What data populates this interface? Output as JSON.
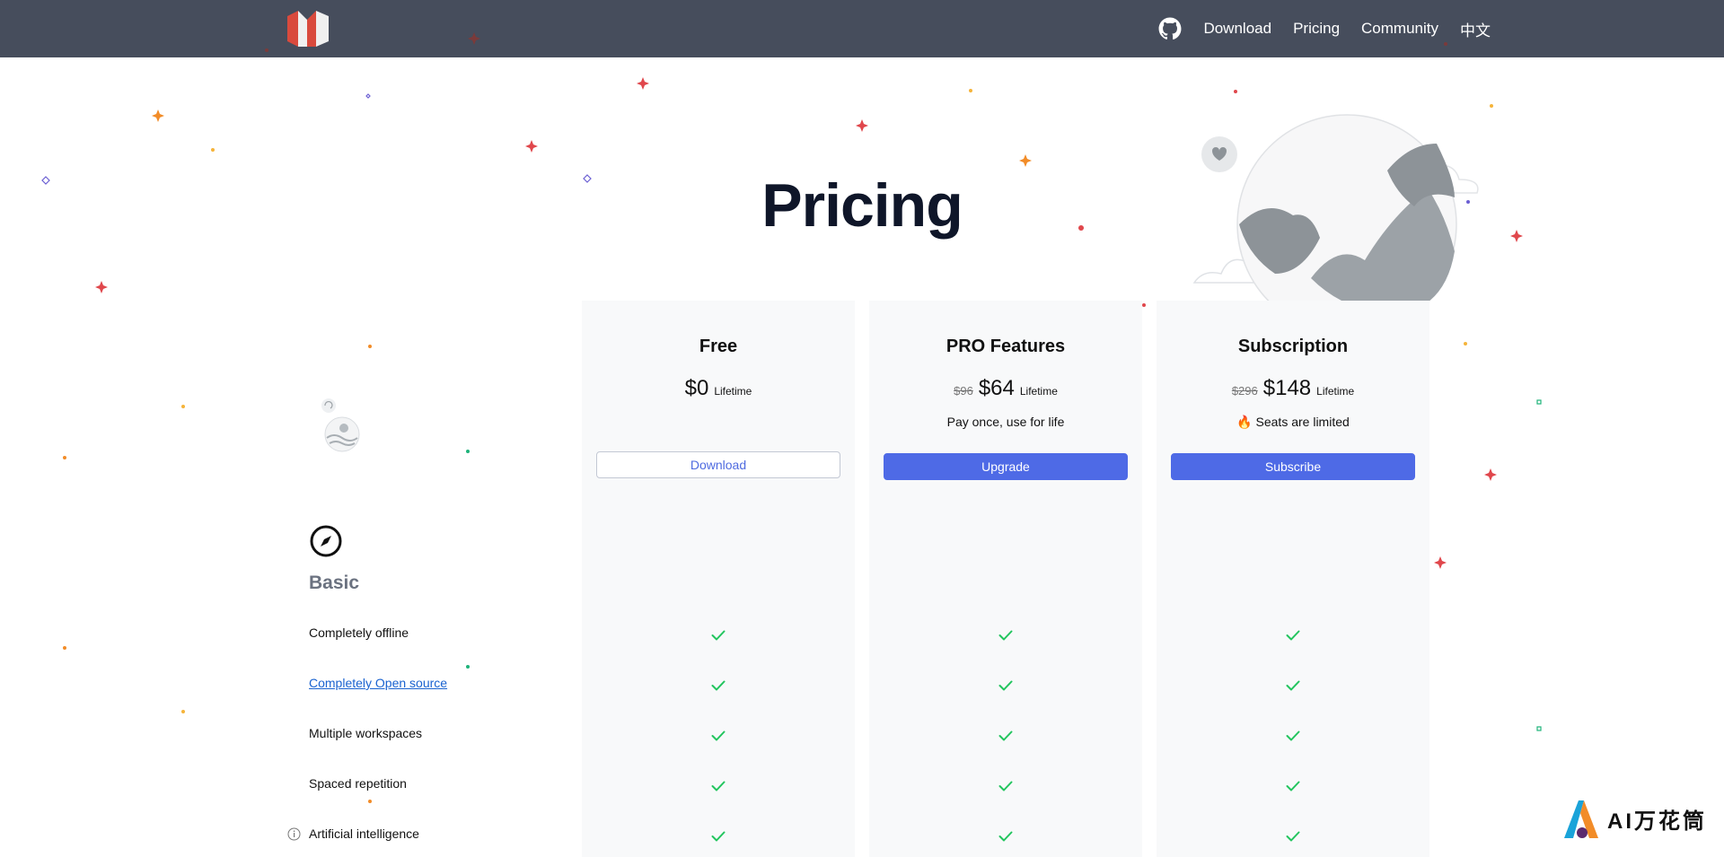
{
  "nav": {
    "links": [
      "Download",
      "Pricing",
      "Community",
      "中文"
    ],
    "icons": {
      "logo": "app-logo",
      "github": "github-icon"
    }
  },
  "page": {
    "title": "Pricing"
  },
  "plans": [
    {
      "name": "Free",
      "old_price": "",
      "price": "$0",
      "period": "Lifetime",
      "note": "",
      "button": "Download",
      "button_style": "outline"
    },
    {
      "name": "PRO Features",
      "old_price": "$96",
      "price": "$64",
      "period": "Lifetime",
      "note": "Pay once, use for life",
      "button": "Upgrade",
      "button_style": "primary"
    },
    {
      "name": "Subscription",
      "old_price": "$296",
      "price": "$148",
      "period": "Lifetime",
      "note": "🔥 Seats are limited",
      "button": "Subscribe",
      "button_style": "primary"
    }
  ],
  "section": {
    "title": "Basic",
    "icon": "compass-icon"
  },
  "features": [
    {
      "label": "Completely offline",
      "link": false,
      "free": true,
      "pro": true,
      "sub": true
    },
    {
      "label": "Completely Open source",
      "link": true,
      "free": true,
      "pro": true,
      "sub": true
    },
    {
      "label": "Multiple workspaces",
      "link": false,
      "free": true,
      "pro": true,
      "sub": true
    },
    {
      "label": "Spaced repetition",
      "link": false,
      "free": true,
      "pro": true,
      "sub": true
    },
    {
      "label": "Artificial intelligence",
      "link": false,
      "info_icon": true,
      "free": true,
      "pro": true,
      "sub": true
    }
  ],
  "watermark": {
    "text": "AI万花筒"
  },
  "colors": {
    "navbar": "#464d5c",
    "accent": "#4e6ae6",
    "check": "#22c55e",
    "column_bg": "#f8f9fa",
    "title": "#0f1629"
  }
}
